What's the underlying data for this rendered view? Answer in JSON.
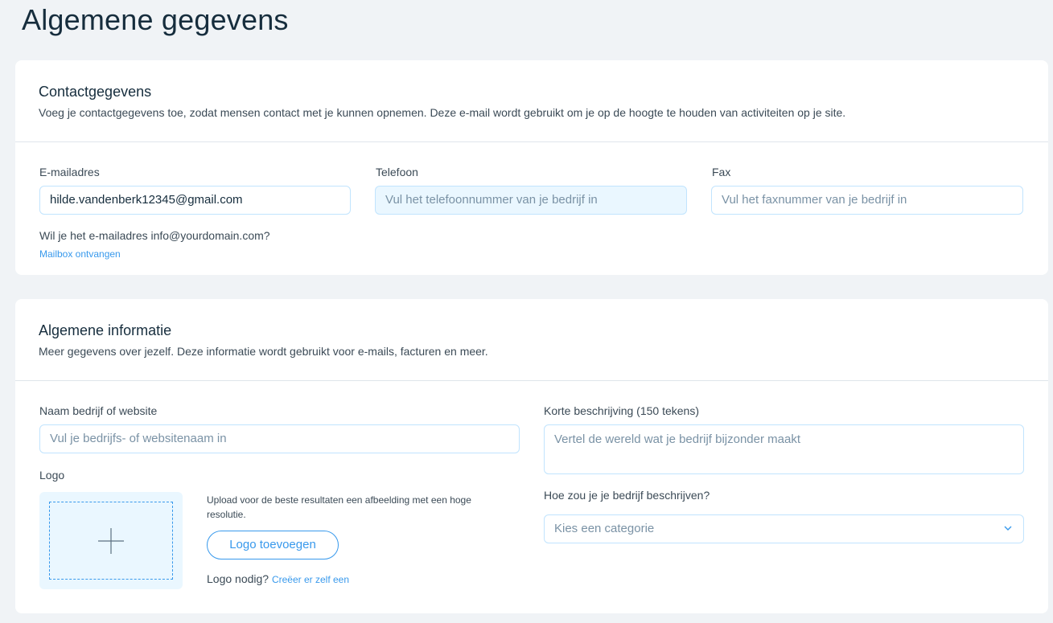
{
  "page": {
    "title": "Algemene gegevens"
  },
  "contact": {
    "title": "Contactgegevens",
    "subtitle": "Voeg je contactgegevens toe, zodat mensen contact met je kunnen opnemen. Deze e-mail wordt gebruikt om je op de hoogte te houden van activiteiten op je site.",
    "email": {
      "label": "E-mailadres",
      "value": "hilde.vandenberk12345@gmail.com"
    },
    "phone": {
      "label": "Telefoon",
      "placeholder": "Vul het telefoonnummer van je bedrijf in"
    },
    "fax": {
      "label": "Fax",
      "placeholder": "Vul het faxnummer van je bedrijf in"
    },
    "mailbox_question": "Wil je het e-mailadres info@yourdomain.com?",
    "mailbox_link": "Mailbox ontvangen"
  },
  "general": {
    "title": "Algemene informatie",
    "subtitle": "Meer gegevens over jezelf. Deze informatie wordt gebruikt voor e-mails, facturen en meer.",
    "company": {
      "label": "Naam bedrijf of website",
      "placeholder": "Vul je bedrijfs- of websitenaam in"
    },
    "description": {
      "label": "Korte beschrijving (150 tekens)",
      "placeholder": "Vertel de wereld wat je bedrijf bijzonder maakt"
    },
    "category": {
      "label": "Hoe zou je je bedrijf beschrijven?",
      "placeholder": "Kies een categorie",
      "icon": "chevron-down-icon"
    },
    "logo": {
      "label": "Logo",
      "upload_hint": "Upload voor de beste resultaten een afbeelding met een hoge resolutie.",
      "add_button": "Logo toevoegen",
      "need_text": "Logo nodig?",
      "create_link": "Creëer er zelf een",
      "icon": "plus-icon"
    }
  },
  "colors": {
    "background": "#f0f3f6",
    "card": "#ffffff",
    "accent": "#3899ec",
    "input_border": "#c1e4fe",
    "input_hover": "#eaf7ff",
    "title": "#162d3d"
  }
}
